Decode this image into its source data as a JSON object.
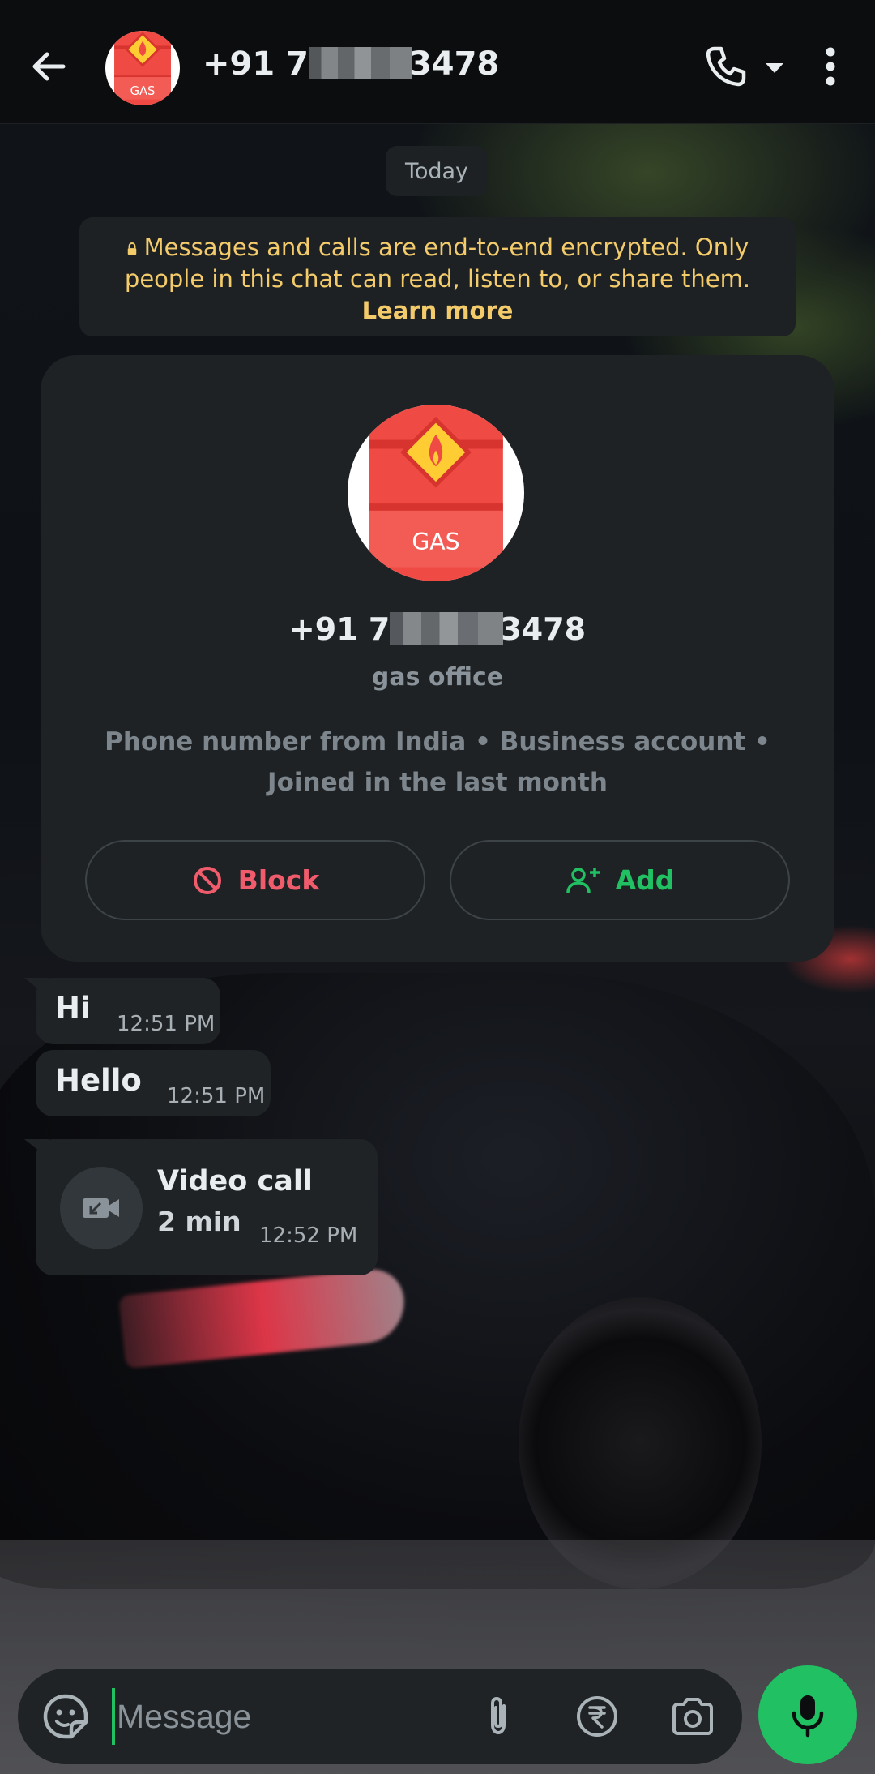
{
  "header": {
    "phone_prefix": "+91 7",
    "phone_suffix": "3478",
    "back_icon": "arrow-left-icon",
    "call_icon": "phone-icon",
    "call_dropdown_icon": "caret-down-icon",
    "menu_icon": "more-vertical-icon"
  },
  "avatar": {
    "label": "GAS",
    "bg_color": "#f04a44",
    "flame_color": "#ffcc33",
    "icon": "gas-cylinder-icon"
  },
  "date_chip": "Today",
  "encryption_notice": {
    "text": "Messages and calls are end-to-end encrypted. Only people in this chat can read, listen to, or share them.",
    "link": "Learn more",
    "icon": "lock-icon",
    "color": "#f3cb6b"
  },
  "business_card": {
    "phone_prefix": "+91 7",
    "phone_suffix": "3478",
    "name": "gas office",
    "meta": "Phone number from India • Business account • Joined in the last month",
    "block_label": "Block",
    "add_label": "Add",
    "block_color": "#f15c6d",
    "add_color": "#21c063"
  },
  "messages": [
    {
      "text": "Hi",
      "time": "12:51 PM"
    },
    {
      "text": "Hello",
      "time": "12:51 PM"
    }
  ],
  "call_message": {
    "title": "Video call",
    "duration": "2 min",
    "time": "12:52 PM",
    "icon": "missed-video-call-icon"
  },
  "composer": {
    "placeholder": "Message",
    "icons": [
      "sticker-emoji-icon",
      "paperclip-icon",
      "rupee-icon",
      "camera-icon"
    ],
    "send_icon": "microphone-icon",
    "accent": "#21c063"
  }
}
